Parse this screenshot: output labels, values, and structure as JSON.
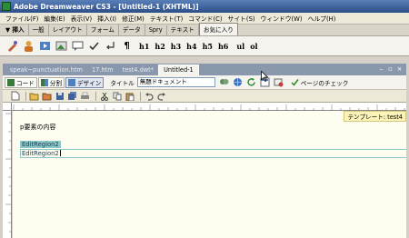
{
  "window": {
    "title": "Adobe Dreamweaver CS3 - [Untitled-1 (XHTML)]"
  },
  "menu": [
    "ファイル(F)",
    "編集(E)",
    "表示(V)",
    "挿入(I)",
    "修正(M)",
    "テキスト(T)",
    "コマンド(C)",
    "サイト(S)",
    "ウィンドウ(W)",
    "ヘルプ(H)"
  ],
  "insert_bar": {
    "menu_label": "▼ 挿入",
    "tabs": [
      "一般",
      "レイアウト",
      "フォーム",
      "データ",
      "Spry",
      "テキスト",
      "お気に入り"
    ],
    "active_tab": "お気に入り"
  },
  "favorites": {
    "paragraph": "¶",
    "headings": [
      "h1",
      "h2",
      "h3",
      "h4",
      "h5",
      "h6"
    ],
    "lists": [
      "ul",
      "ol"
    ]
  },
  "document_tabs": [
    "speak~punctuation.htm",
    "17.htm",
    "test4.dwt*",
    "Untitled-1"
  ],
  "active_document": "Untitled-1",
  "doc_toolbar": {
    "code": "コード",
    "split": "分割",
    "design": "デザイン",
    "title_label": "タイトル",
    "title_value": "無題ドキュメント",
    "page_check": "ページのチェック"
  },
  "content": {
    "template_badge": "テンプレート: test4",
    "paragraph": "p要素の内容",
    "editable_region_tab": "EditRegion2",
    "editable_region_body": "EditRegion2"
  }
}
